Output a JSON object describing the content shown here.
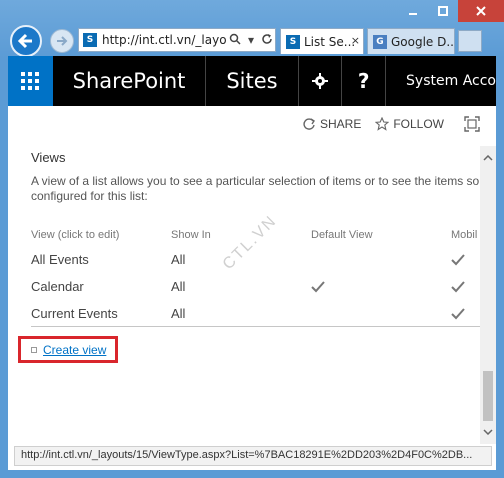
{
  "browser": {
    "address_url": "http://int.ctl.vn/_layou",
    "tabs": [
      {
        "label": "List Se..."
      },
      {
        "label": "Google D..."
      }
    ],
    "status_url": "http://int.ctl.vn/_layouts/15/ViewType.aspx?List=%7BAC18291E%2DD203%2D4F0C%2DB..."
  },
  "suitebar": {
    "brand": "SharePoint",
    "sites_label": "Sites",
    "account_label": "System Acco",
    "help_label": "?"
  },
  "actions": {
    "share_label": "SHARE",
    "follow_label": "FOLLOW"
  },
  "views_section": {
    "title": "Views",
    "description_line1": "A view of a list allows you to see a particular selection of items or to see the items sorte",
    "description_line2": "configured for this list:",
    "columns": [
      "View (click to edit)",
      "Show In",
      "Default View",
      "Mobil"
    ],
    "rows": [
      {
        "name": "All Events",
        "show_in": "All",
        "default_view": false,
        "mobile": true
      },
      {
        "name": "Calendar",
        "show_in": "All",
        "default_view": true,
        "mobile": true
      },
      {
        "name": "Current Events",
        "show_in": "All",
        "default_view": false,
        "mobile": true
      }
    ],
    "create_view_label": "Create view"
  },
  "watermark": "CTL.VN",
  "colors": {
    "suitebar": "#000000",
    "waffle": "#0072c6",
    "link": "#0072c6",
    "highlight_box": "#d9262c"
  }
}
